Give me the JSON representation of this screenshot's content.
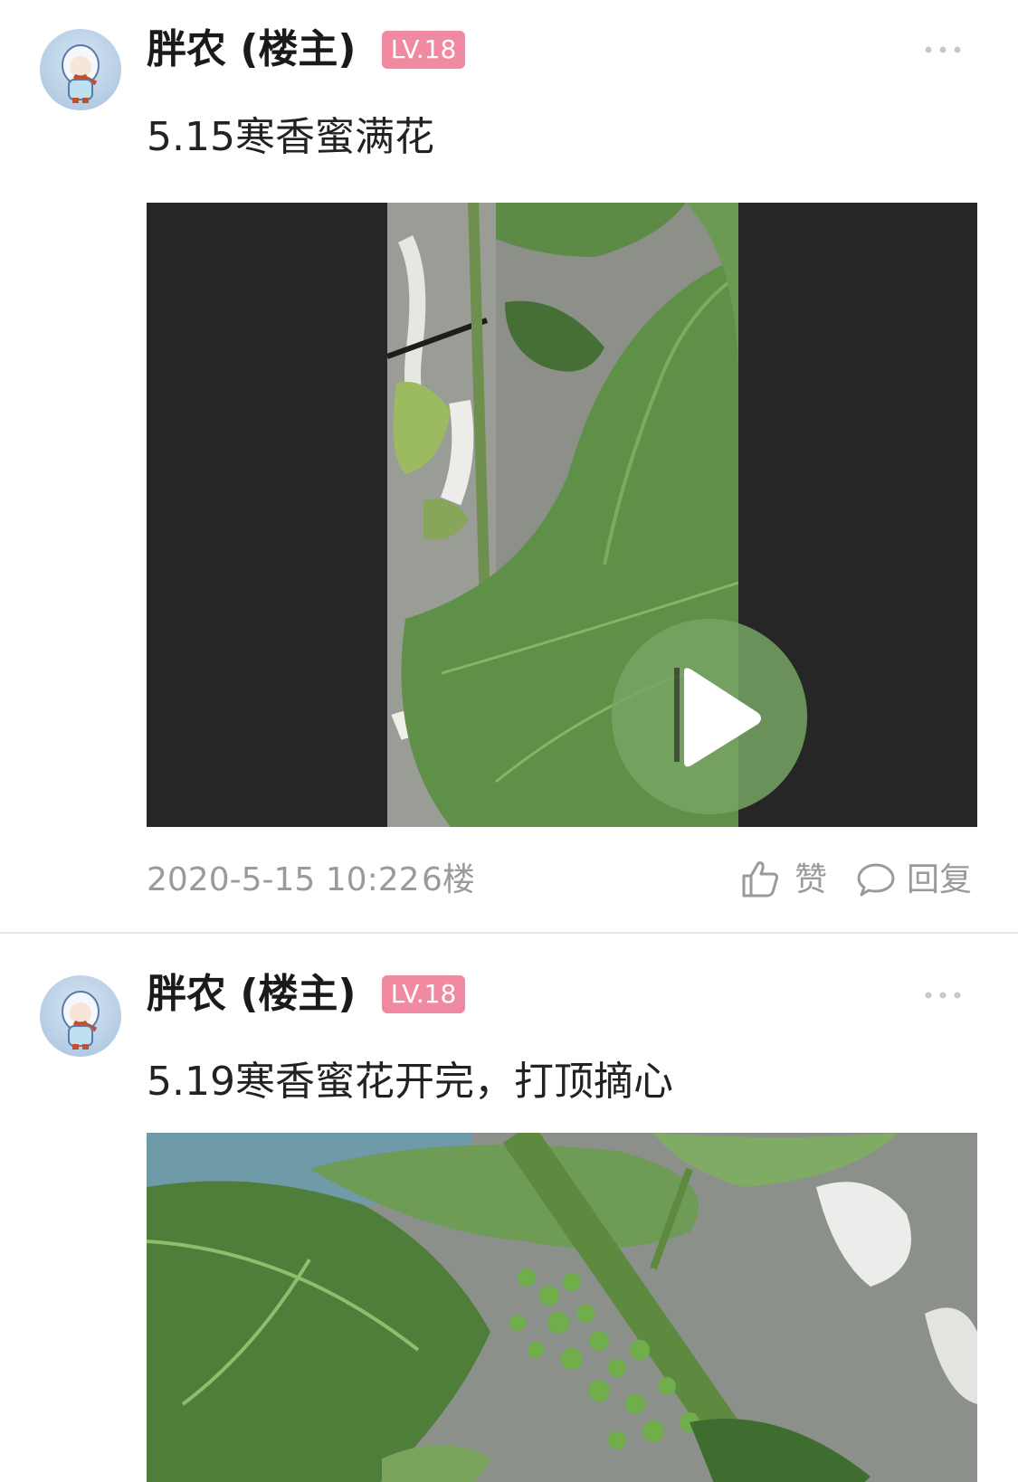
{
  "posts": [
    {
      "author": "胖农 (楼主)",
      "level": "LV.18",
      "text": "5.15寒香蜜满花",
      "media": "video",
      "timestamp": "2020-5-15 10:22",
      "floor": "6楼",
      "like_label": "赞",
      "reply_label": "回复"
    },
    {
      "author": "胖农 (楼主)",
      "level": "LV.18",
      "text": "5.19寒香蜜花开完，打顶摘心",
      "media": "image"
    }
  ],
  "icons": {
    "more": "more-icon",
    "play": "play-icon",
    "like": "thumbs-up-icon",
    "reply": "comment-bubble-icon"
  },
  "colors": {
    "level_badge": "#f08aa0",
    "meta_text": "#9a9a9a",
    "video_bg": "#262626"
  }
}
